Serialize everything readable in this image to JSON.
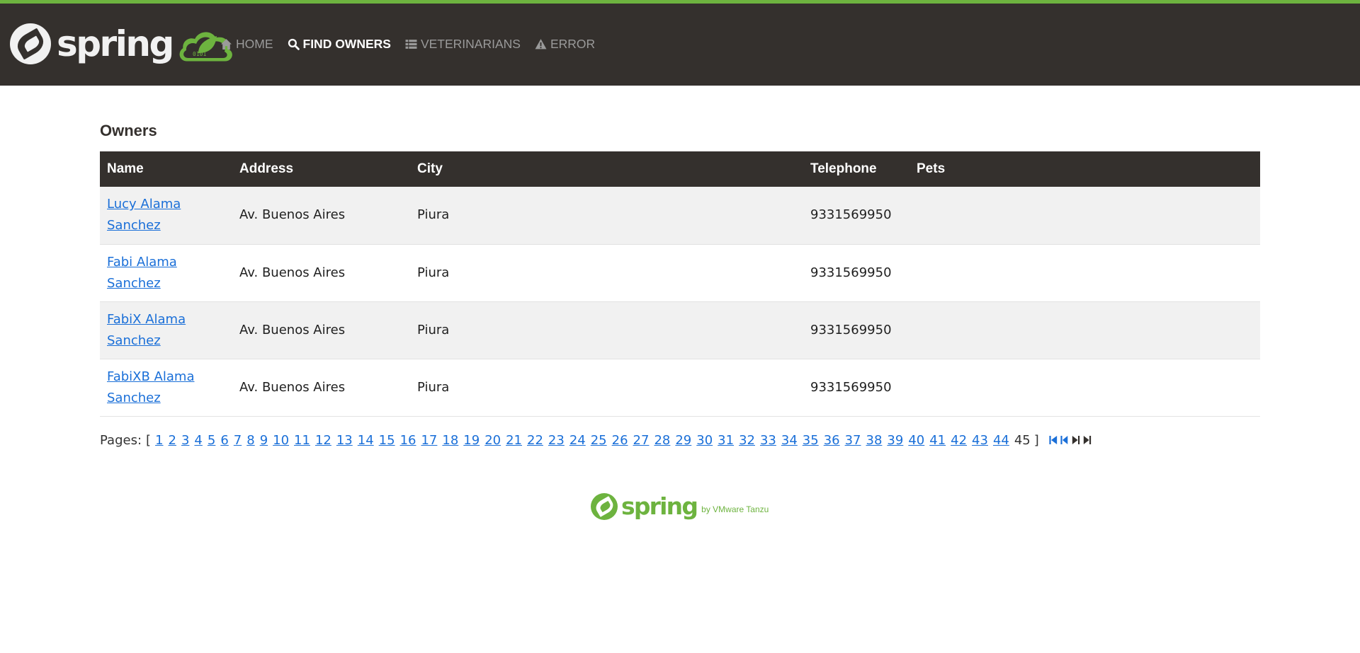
{
  "brand": {
    "name": "spring",
    "badge_icon": "spring-cloud-logo-icon"
  },
  "nav": {
    "items": [
      {
        "label": "HOME",
        "icon": "home-icon",
        "active": false
      },
      {
        "label": "FIND OWNERS",
        "icon": "search-icon",
        "active": true
      },
      {
        "label": "VETERINARIANS",
        "icon": "list-icon",
        "active": false
      },
      {
        "label": "ERROR",
        "icon": "warning-icon",
        "active": false
      }
    ]
  },
  "main": {
    "title": "Owners",
    "table": {
      "columns": [
        "Name",
        "Address",
        "City",
        "Telephone",
        "Pets"
      ],
      "rows": [
        {
          "name_line1": "Lucy Alama",
          "name_line2": "Sanchez",
          "address": "Av. Buenos Aires",
          "city": "Piura",
          "telephone": "9331569950",
          "pets": ""
        },
        {
          "name_line1": "Fabi Alama",
          "name_line2": "Sanchez",
          "address": "Av. Buenos Aires",
          "city": "Piura",
          "telephone": "9331569950",
          "pets": ""
        },
        {
          "name_line1": "FabiX Alama",
          "name_line2": "Sanchez",
          "address": "Av. Buenos Aires",
          "city": "Piura",
          "telephone": "9331569950",
          "pets": ""
        },
        {
          "name_line1": "FabiXB Alama",
          "name_line2": "Sanchez",
          "address": "Av. Buenos Aires",
          "city": "Piura",
          "telephone": "9331569950",
          "pets": ""
        }
      ]
    },
    "pagination": {
      "label": "Pages:",
      "open_bracket": "[",
      "close_bracket": "]",
      "pages": [
        "1",
        "2",
        "3",
        "4",
        "5",
        "6",
        "7",
        "8",
        "9",
        "10",
        "11",
        "12",
        "13",
        "14",
        "15",
        "16",
        "17",
        "18",
        "19",
        "20",
        "21",
        "22",
        "23",
        "24",
        "25",
        "26",
        "27",
        "28",
        "29",
        "30",
        "31",
        "32",
        "33",
        "34",
        "35",
        "36",
        "37",
        "38",
        "39",
        "40",
        "41",
        "42",
        "43",
        "44"
      ],
      "current_page": "45",
      "nav_icons": [
        "first-page-icon",
        "previous-page-icon",
        "next-page-icon",
        "last-page-icon"
      ]
    }
  },
  "footer": {
    "brand": "spring",
    "byline": "by VMware Tanzu"
  },
  "colors": {
    "navbar_bg": "#34302d",
    "accent_green": "#6db33f",
    "link_blue": "#1a6fd8",
    "row_stripe": "#f1f1f1"
  }
}
